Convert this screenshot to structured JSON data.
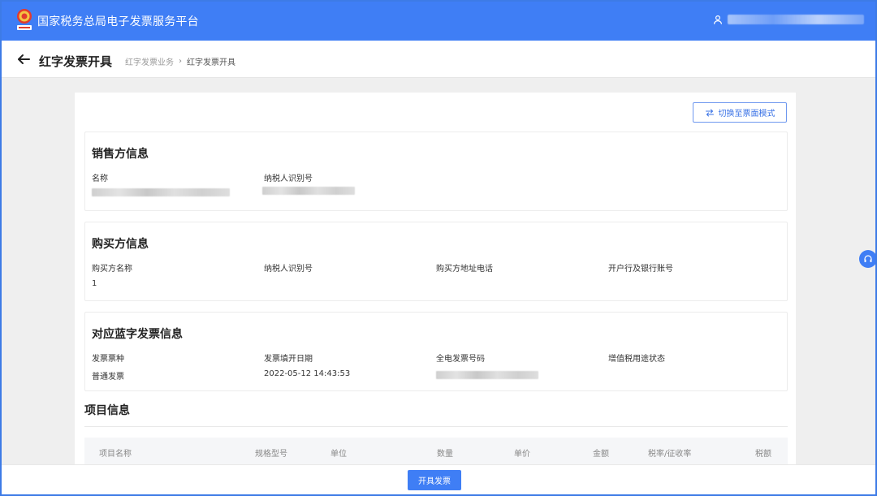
{
  "app": {
    "title": "国家税务总局电子发票服务平台"
  },
  "header": {
    "page_title": "红字发票开具",
    "breadcrumb": [
      "红字发票业务",
      "红字发票开具"
    ],
    "breadcrumb_sep": "›"
  },
  "toolbar": {
    "switch_label": "切换至票面模式"
  },
  "seller": {
    "title": "销售方信息",
    "fields": {
      "name_label": "名称",
      "tax_id_label": "纳税人识别号"
    }
  },
  "buyer": {
    "title": "购买方信息",
    "fields": {
      "name_label": "购买方名称",
      "tax_id_label": "纳税人识别号",
      "address_phone_label": "购买方地址电话",
      "bank_account_label": "开户行及银行账号",
      "name_value": "1"
    }
  },
  "blue_invoice": {
    "title": "对应蓝字发票信息",
    "fields": {
      "invoice_type_label": "发票票种",
      "issue_date_label": "发票填开日期",
      "number_label": "全电发票号码",
      "vat_status_label": "增值税用途状态",
      "invoice_type_value": "普通发票",
      "issue_date_value": "2022-05-12 14:43:53"
    }
  },
  "items": {
    "title": "项目信息",
    "columns": [
      "项目名称",
      "规格型号",
      "单位",
      "数量",
      "单价",
      "金额",
      "税率/征收率",
      "税额"
    ]
  },
  "actions": {
    "issue_label": "开具发票"
  },
  "colors": {
    "brand_blue": "#3f7ef5",
    "border_blue": "#3d7be6"
  }
}
